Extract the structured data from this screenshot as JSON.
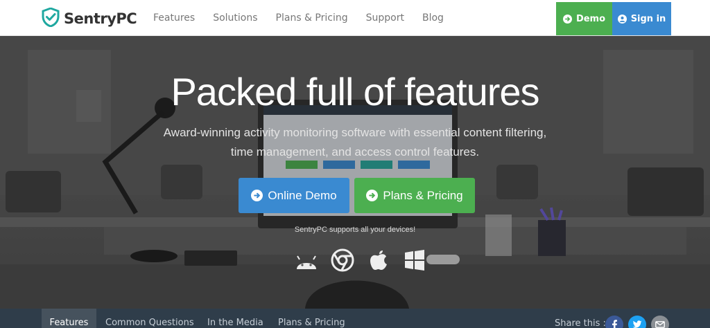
{
  "header": {
    "logo_text": "SentryPC",
    "nav": [
      "Features",
      "Solutions",
      "Plans & Pricing",
      "Support",
      "Blog"
    ],
    "demo_label": "Demo",
    "signin_label": "Sign in"
  },
  "hero": {
    "title": "Packed full of features",
    "subtitle": "Award-winning activity monitoring software with essential content filtering, time management, and access control features.",
    "online_demo": "Online Demo",
    "plans_pricing": "Plans & Pricing",
    "devices_text": "SentryPC supports all your devices!",
    "device_icons": [
      "android-icon",
      "chrome-icon",
      "apple-icon",
      "windows-icon"
    ]
  },
  "subnav": {
    "tabs": [
      "Features",
      "Common Questions",
      "In the Media",
      "Plans & Pricing"
    ],
    "active": "Features",
    "share_label": "Share this :",
    "social_icons": [
      "facebook-icon",
      "twitter-icon",
      "email-icon"
    ]
  },
  "colors": {
    "green": "#4caf50",
    "blue": "#3a8ad1",
    "subnav_bg": "#2f3d4a",
    "facebook": "#3b5998",
    "twitter": "#1da1f2",
    "email": "#8a8f94"
  }
}
